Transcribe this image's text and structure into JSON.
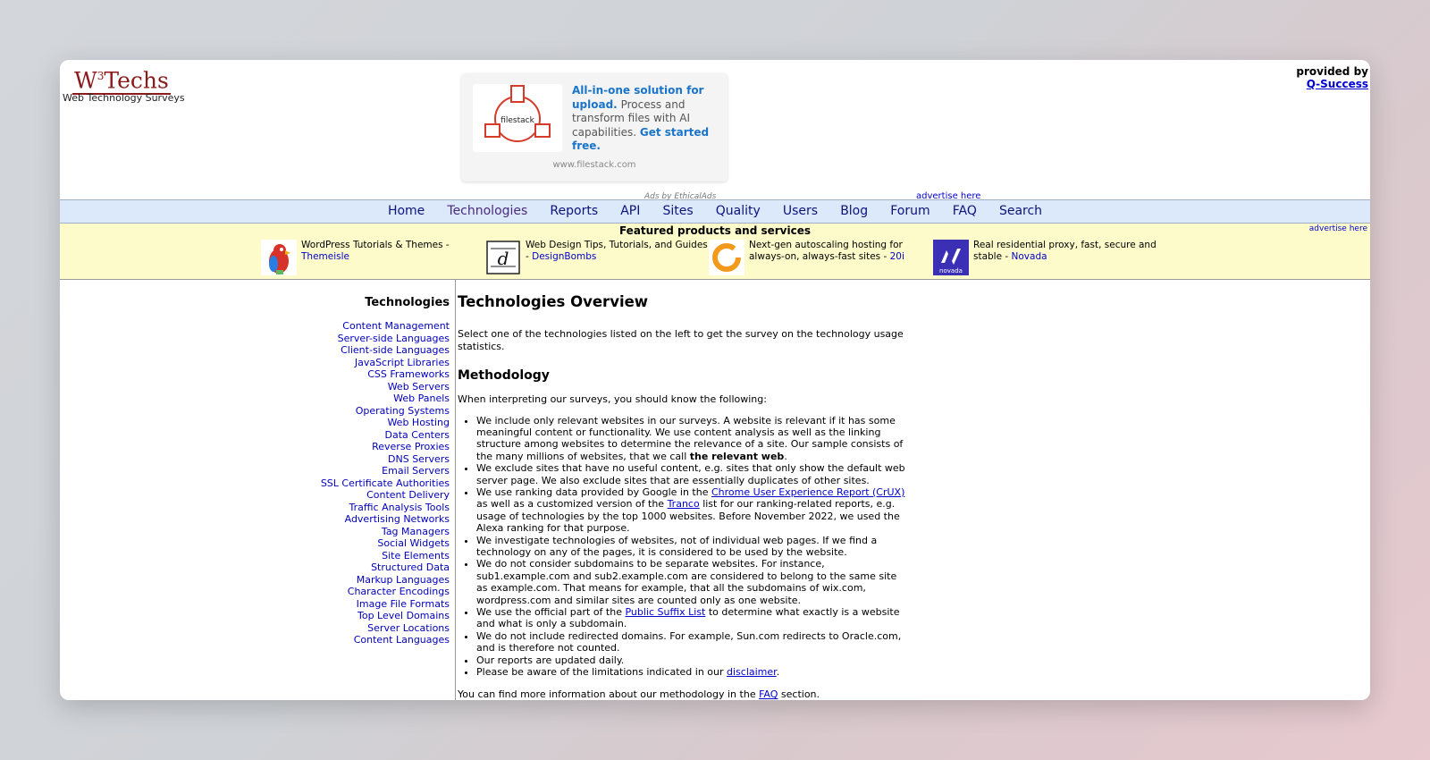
{
  "site": {
    "logo": "W3Techs",
    "logo_prefix": "W",
    "logo_sup": "3",
    "logo_suffix": "Techs",
    "tagline": "Web Technology Surveys"
  },
  "provider": {
    "label": "provided by",
    "link": "Q-Success"
  },
  "ad": {
    "image_label": "filestack",
    "text_hl1": "All-in-one solution for upload.",
    "text_body": " Process and transform files with AI capabilities. ",
    "text_hl2": "Get started free.",
    "domain": "www.filestack.com",
    "by": "Ads by EthicalAds",
    "advertise": "advertise here"
  },
  "nav": [
    "Home",
    "Technologies",
    "Reports",
    "API",
    "Sites",
    "Quality",
    "Users",
    "Blog",
    "Forum",
    "FAQ",
    "Search"
  ],
  "featured": {
    "title": "Featured products and services",
    "advertise": "advertise here",
    "items": [
      {
        "text": "WordPress Tutorials & Themes - ",
        "link": "Themeisle",
        "icon": "parrot-icon"
      },
      {
        "text": "Web Design Tips, Tutorials, and Guides - ",
        "link": "DesignBombs",
        "icon": "designbombs-d-icon"
      },
      {
        "text": "Next-gen autoscaling hosting for always-on, always-fast sites - ",
        "link": "20i",
        "icon": "20i-ring-icon"
      },
      {
        "text": "Real residential proxy, fast, secure and stable - ",
        "link": "Novada",
        "icon": "novada-icon",
        "logo_word": "novada"
      }
    ]
  },
  "sidebar": {
    "title": "Technologies",
    "items": [
      "Content Management",
      "Server-side Languages",
      "Client-side Languages",
      "JavaScript Libraries",
      "CSS Frameworks",
      "Web Servers",
      "Web Panels",
      "Operating Systems",
      "Web Hosting",
      "Data Centers",
      "Reverse Proxies",
      "DNS Servers",
      "Email Servers",
      "SSL Certificate Authorities",
      "Content Delivery",
      "Traffic Analysis Tools",
      "Advertising Networks",
      "Tag Managers",
      "Social Widgets",
      "Site Elements",
      "Structured Data",
      "Markup Languages",
      "Character Encodings",
      "Image File Formats",
      "Top Level Domains",
      "Server Locations",
      "Content Languages"
    ]
  },
  "main": {
    "title": "Technologies Overview",
    "intro": "Select one of the technologies listed on the left to get the survey on the technology usage statistics.",
    "methodology_title": "Methodology",
    "methodology_intro": "When interpreting our surveys, you should know the following:",
    "b1_text": "We include only relevant websites in our surveys. A website is relevant if it has some meaningful content or functionality. We use content analysis as well as the linking structure among websites to determine the relevance of a site. Our sample consists of the many millions of websites, that we call ",
    "b1_bold": "the relevant web",
    "b1_end": ".",
    "b2": "We exclude sites that have no useful content, e.g. sites that only show the default web server page. We also exclude sites that are essentially duplicates of other sites.",
    "b3_a": "We use ranking data provided by Google in the ",
    "b3_link1": "Chrome User Experience Report (CrUX)",
    "b3_b": " as well as a customized version of the ",
    "b3_link2": "Tranco",
    "b3_c": " list for our ranking-related reports, e.g. usage of technologies by the top 1000 websites. Before November 2022, we used the Alexa ranking for that purpose.",
    "b4": "We investigate technologies of websites, not of individual web pages. If we find a technology on any of the pages, it is considered to be used by the website.",
    "b5": "We do not consider subdomains to be separate websites. For instance, sub1.example.com and sub2.example.com are considered to belong to the same site as example.com. That means for example, that all the subdomains of wix.com, wordpress.com and similar sites are counted only as one website.",
    "b6_a": "We use the official part of the ",
    "b6_link": "Public Suffix List",
    "b6_b": " to determine what exactly is a website and what is only a subdomain.",
    "b7": "We do not include redirected domains. For example, Sun.com redirects to Oracle.com, and is therefore not counted.",
    "b8": "Our reports are updated daily.",
    "b9_a": "Please be aware of the limitations indicated in our ",
    "b9_link": "disclaimer",
    "b9_b": ".",
    "more_a": "You can find more information about our methodology in the ",
    "more_link": "FAQ",
    "more_b": " section."
  }
}
